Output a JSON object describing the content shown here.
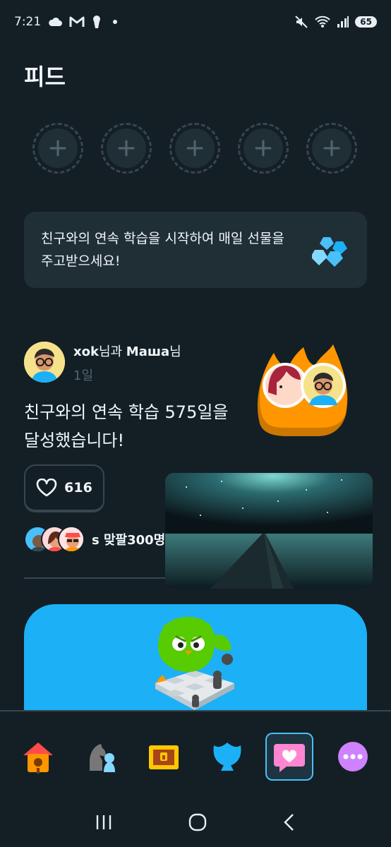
{
  "status_bar": {
    "time": "7:21",
    "battery": "65"
  },
  "page": {
    "title": "피드"
  },
  "friend_slots": {
    "count": 5
  },
  "banner": {
    "text": "친구와의 연속 학습을 시작하여 매일 선물을 주고받으세요!",
    "icon": "gems-icon"
  },
  "feed_item": {
    "author_user": "xok",
    "author_suffix": "님과 ",
    "author_friend": "Маша",
    "author_friend_suffix": "님",
    "time": "1일",
    "headline": "친구와의 연속 학습 575일을 달성했습니다!",
    "like_count": "616",
    "likers_text": "s 맞팔300명"
  },
  "promo": {
    "icon": "duo-chess-illustration"
  },
  "tabs": [
    {
      "name": "learn",
      "icon": "home-icon",
      "active": false
    },
    {
      "name": "chess",
      "icon": "chess-icon",
      "active": false
    },
    {
      "name": "quests",
      "icon": "chest-icon",
      "active": false
    },
    {
      "name": "leagues",
      "icon": "shield-icon",
      "active": false
    },
    {
      "name": "feed",
      "icon": "feed-icon",
      "active": true
    },
    {
      "name": "more",
      "icon": "more-icon",
      "active": false
    }
  ],
  "colors": {
    "background": "#131f24",
    "card": "#202f36",
    "border": "#37464f",
    "promo_blue": "#1cb0f6",
    "active_tab": "#49c0f8",
    "streak_orange": "#ff9600",
    "muted_text": "#52656d"
  }
}
